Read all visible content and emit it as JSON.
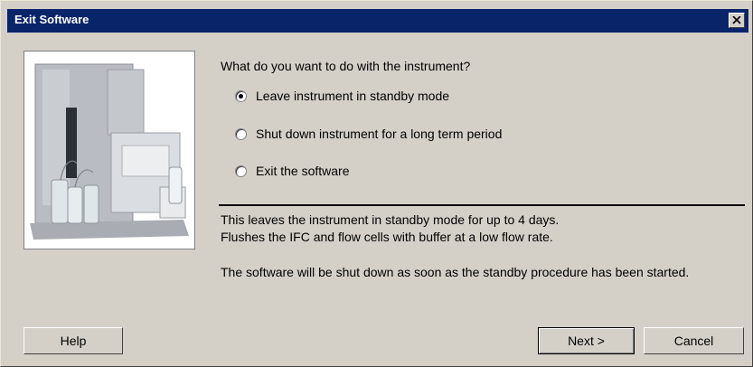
{
  "window": {
    "title": "Exit Software"
  },
  "image": {
    "icon": "instrument-photo"
  },
  "question": "What do you want to do with the instrument?",
  "options": [
    {
      "label": "Leave instrument in standby mode",
      "selected": true
    },
    {
      "label": "Shut down instrument for a long term period",
      "selected": false
    },
    {
      "label": "Exit the software",
      "selected": false
    }
  ],
  "description": {
    "line1": "This leaves the instrument in standby mode for up to 4 days.",
    "line2": "Flushes the IFC and flow cells with buffer at a low flow rate.",
    "line3": "The software will be shut down as soon as the standby procedure has been started."
  },
  "buttons": {
    "help": "Help",
    "next": "Next >",
    "cancel": "Cancel"
  },
  "colors": {
    "titlebar": "#0a246a",
    "face": "#d4d0c8"
  }
}
